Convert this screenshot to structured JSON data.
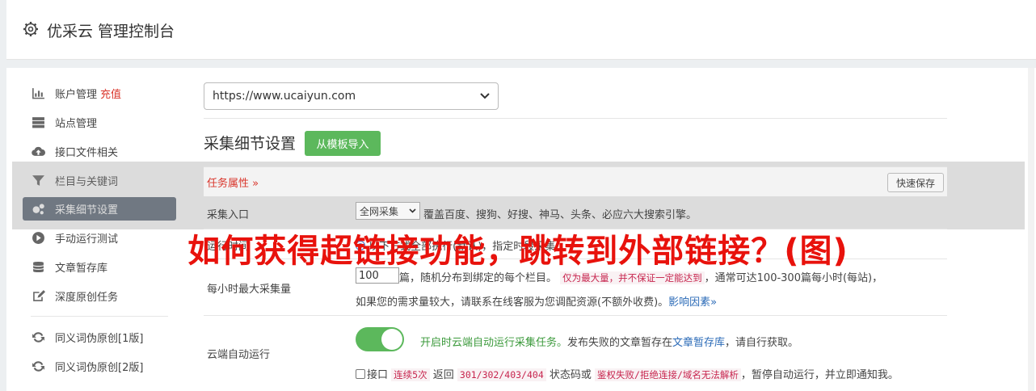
{
  "header": {
    "title": "优采云 管理控制台"
  },
  "sidebar": {
    "items": [
      {
        "label": "账户管理",
        "badge": "充值",
        "icon": "bar-chart-icon"
      },
      {
        "label": "站点管理",
        "icon": "server-icon"
      },
      {
        "label": "接口文件相关",
        "icon": "cloud-upload-icon"
      },
      {
        "label": "栏目与关键词",
        "icon": "filter-icon"
      },
      {
        "label": "采集细节设置",
        "icon": "gears-icon",
        "active": true
      },
      {
        "label": "手动运行测试",
        "icon": "play-circle-icon"
      },
      {
        "label": "文章暂存库",
        "icon": "database-icon"
      },
      {
        "label": "深度原创任务",
        "icon": "edit-icon"
      },
      {
        "label": "同义词伪原创[1版]",
        "icon": "refresh-icon"
      },
      {
        "label": "同义词伪原创[2版]",
        "icon": "refresh-icon"
      }
    ]
  },
  "site_select": {
    "value": "https://www.ucaiyun.com"
  },
  "section": {
    "title": "采集细节设置",
    "import_button": "从模板导入"
  },
  "task": {
    "label": "任务属性 »",
    "save_button": "快速保存"
  },
  "rows": {
    "entry": {
      "label": "采集入口",
      "select": "全网采集",
      "desc": "覆盖百度、搜狗、好搜、神马、头条、必应六大搜索引擎。"
    },
    "mode": {
      "label": "运行时间",
      "desc": "以下方式全部执行(默认)，指定时段采集"
    },
    "max": {
      "label": "每小时最大采集量",
      "value": "100",
      "desc1": "篇，随机分布到绑定的每个栏目。",
      "code1": "仅为最大量，并不保证一定能达到",
      "desc2": "，通常可达100-300篇每小时(每站)，",
      "desc3": "如果您的需求量较大，请联系在线客服为您调配资源(不额外收费)。",
      "link": "影响因素»"
    },
    "cloud": {
      "label": "云端自动运行",
      "status": "开启时云端自动运行采集任务。",
      "desc1": "发布失败的文章暂存在",
      "link": "文章暂存库",
      "desc2": "，请自行获取。",
      "cb_label": "接口",
      "code1": "连续5次",
      "t1": "返回",
      "code2": "301/302/403/404",
      "t2": "状态码或",
      "code3": "鉴权失败/拒绝连接/域名无法解析",
      "t3": "，暂停自动运行，并立即通知我。"
    }
  },
  "overlay": {
    "text": "如何获得超链接功能，跳转到外部链接？(图)"
  },
  "colors": {
    "accent_green": "#5cb85c",
    "active_nav": "#5f6b7a",
    "red": "#d9352b",
    "link_blue": "#2a6ab7"
  }
}
